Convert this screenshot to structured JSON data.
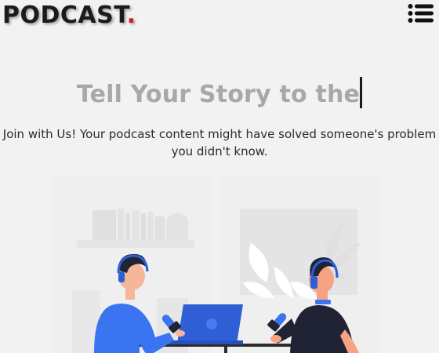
{
  "header": {
    "logo_text": "PODCAST",
    "logo_dot": ".",
    "menu_icon": "list-menu-icon"
  },
  "hero": {
    "title": "Tell Your Story to the",
    "subtitle_line1": "Join with Us! Your podcast content might have solved someone's problem",
    "subtitle_line2": "you didn't know."
  },
  "colors": {
    "background": "#f2f2f2",
    "logo": "#1b1b1b",
    "logo_dot": "#d32020",
    "title": "#a8a8a8",
    "accent_blue": "#3b74f0"
  },
  "illustration": {
    "icon": "podcast-recording-illustration"
  }
}
